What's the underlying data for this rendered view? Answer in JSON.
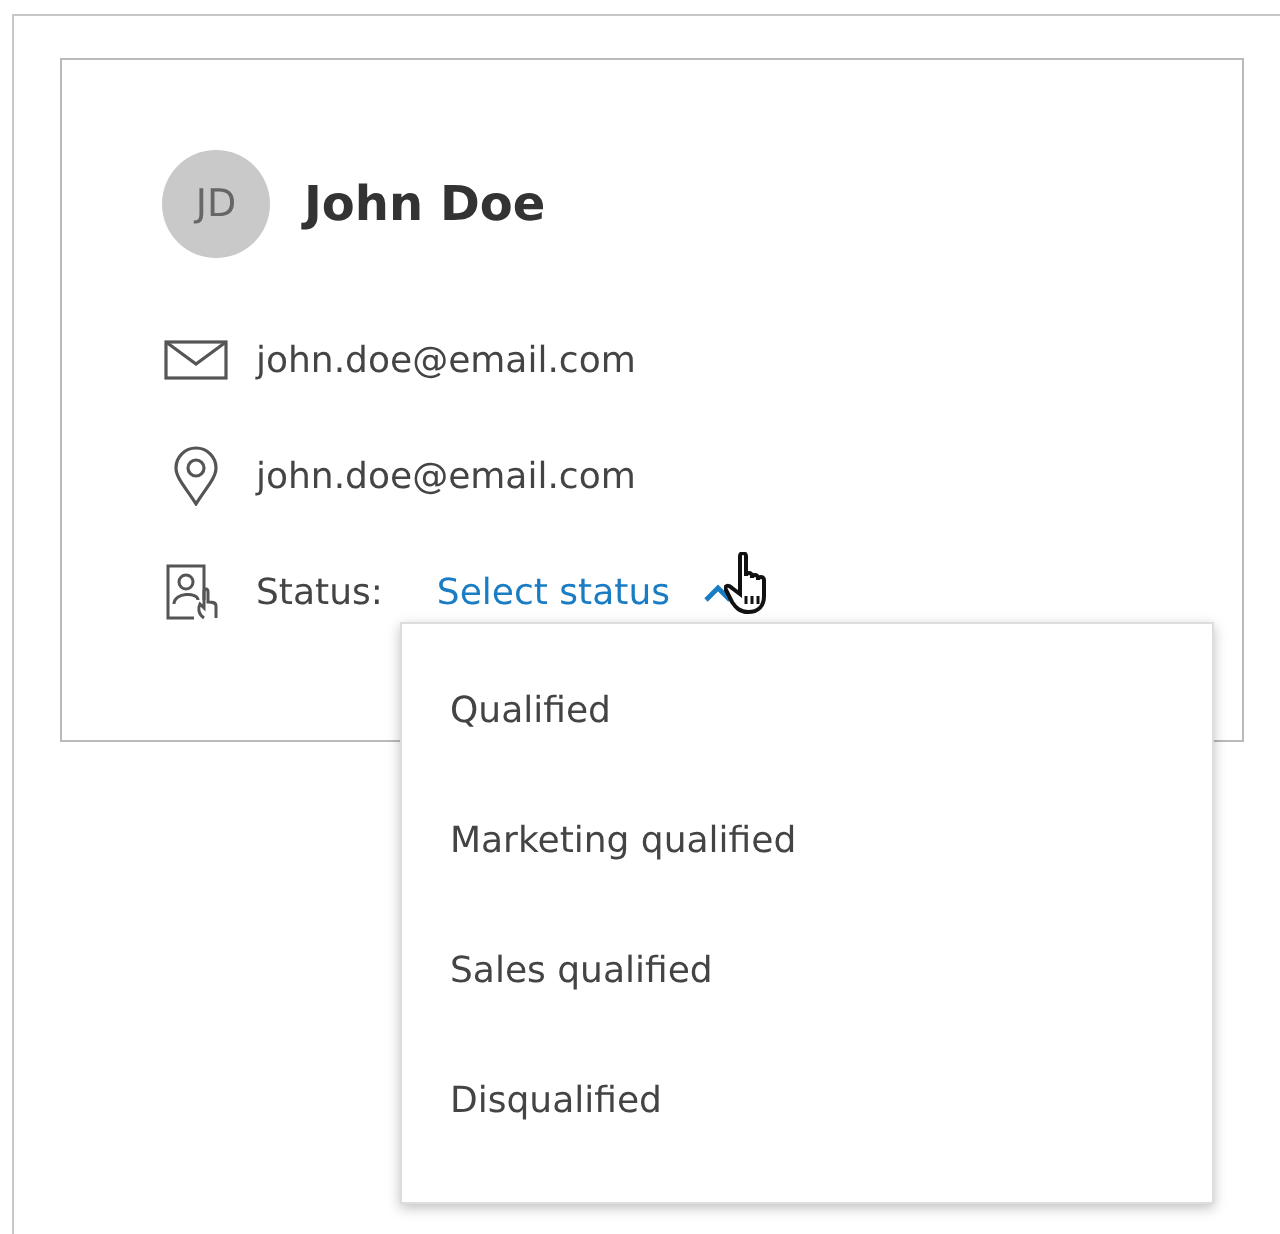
{
  "contact": {
    "initials": "JD",
    "name": "John Doe",
    "details": [
      {
        "kind": "email",
        "text": "john.doe@email.com"
      },
      {
        "kind": "location",
        "text": "john.doe@email.com"
      }
    ],
    "status": {
      "label": "Status:",
      "link": "Select status",
      "expanded": true
    }
  },
  "status_menu": [
    {
      "label": "Qualified"
    },
    {
      "label": "Marketing qualified"
    },
    {
      "label": "Sales qualified"
    },
    {
      "label": "Disqualified"
    }
  ]
}
